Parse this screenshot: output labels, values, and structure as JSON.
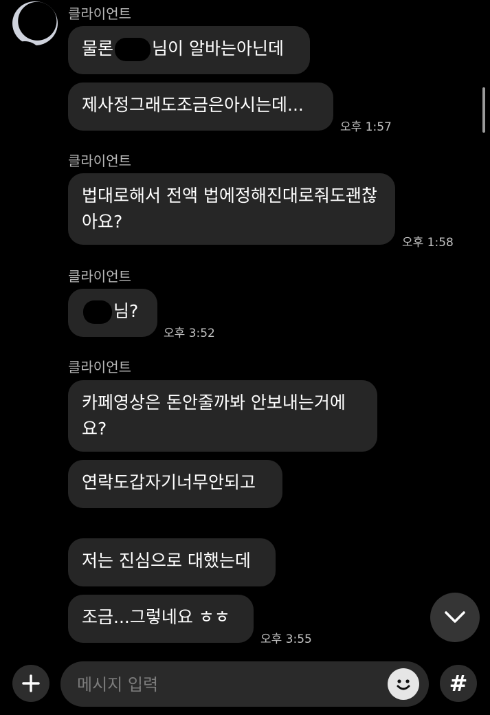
{
  "colors": {
    "background": "#000000",
    "bubble": "#262626",
    "sender_name": "#b9b9b9",
    "timestamp": "#c2c2c2"
  },
  "sender_name": "클라이언트",
  "messages": [
    {
      "text_before": "물론",
      "text_after": "님이 알바는아닌데"
    },
    {
      "text": "제사정그래도조금은아시는데...",
      "time": "오후 1:57"
    },
    {
      "text": "법대로해서 전액 법에정해진대로줘도괜찮아요?",
      "time": "오후 1:58"
    },
    {
      "text_after": "님?",
      "time": "오후 3:52"
    },
    {
      "text": "카페영상은 돈안줄까봐 안보내는거에요?"
    },
    {
      "text": "연락도갑자기너무안되고"
    },
    {
      "text": "저는 진심으로 대했는데"
    },
    {
      "text": "조금...그렇네요 ㅎㅎ",
      "time": "오후 3:55"
    }
  ],
  "composer": {
    "placeholder": "메시지 입력",
    "hash_label": "#"
  },
  "icons": {
    "scroll_down": "chevron-down-icon",
    "attach": "plus-icon",
    "emoji": "smiley-icon",
    "hashtag": "hash-icon"
  }
}
